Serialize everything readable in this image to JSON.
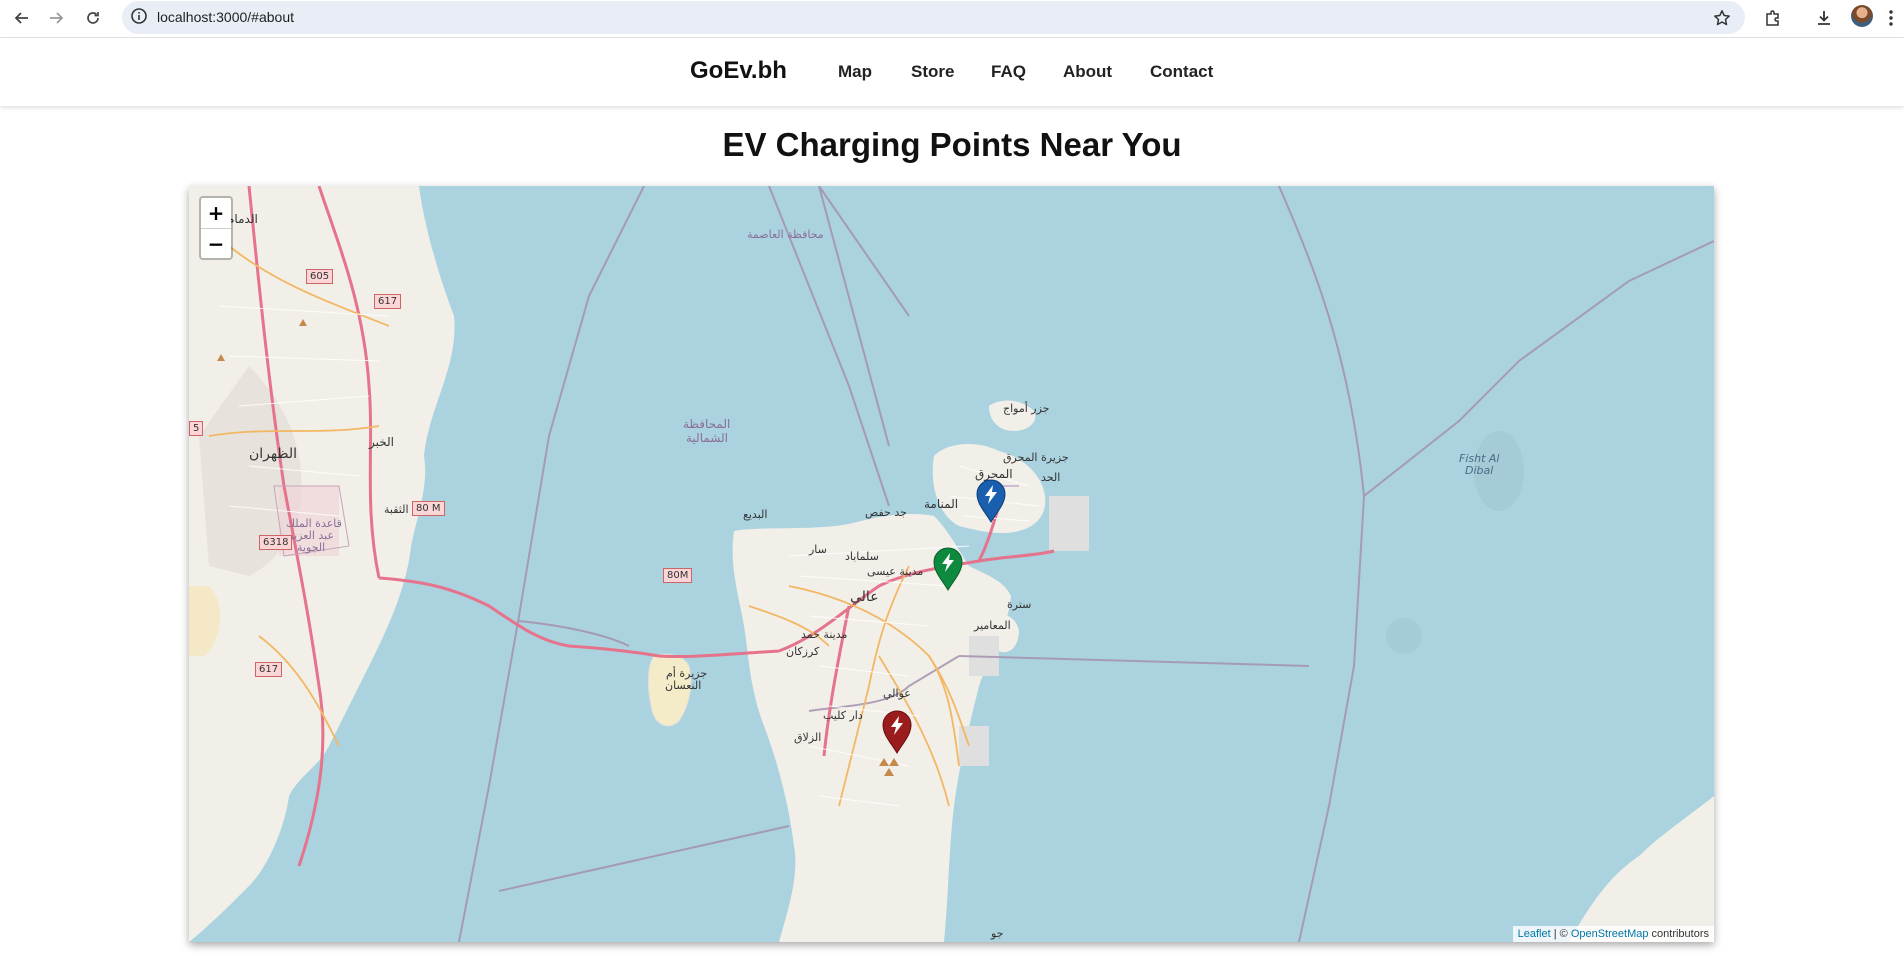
{
  "browser": {
    "url": "localhost:3000/#about"
  },
  "header": {
    "brand": "GoEv.bh",
    "nav": [
      {
        "label": "Map"
      },
      {
        "label": "Store"
      },
      {
        "label": "FAQ"
      },
      {
        "label": "About"
      },
      {
        "label": "Contact"
      }
    ]
  },
  "main": {
    "title": "EV Charging Points Near You"
  },
  "map": {
    "zoom_in": "+",
    "zoom_out": "−",
    "markers": [
      {
        "color": "#1a5fae",
        "name": "blue"
      },
      {
        "color": "#0e8a3f",
        "name": "green"
      },
      {
        "color": "#9b1c1c",
        "name": "red"
      }
    ],
    "labels": {
      "capital_gov": "محافظة العاصمة",
      "northern_gov_1": "المحافظة",
      "northern_gov_2": "الشمالية",
      "muharraq_island": "جزيرة المحرق",
      "muharraq": "المحرق",
      "amwaj": "جزر أمواج",
      "hidd": "الحد",
      "manama": "المنامة",
      "jidhafs": "جد حفص",
      "budaiya": "البديع",
      "saar": "سار",
      "salmabad": "سلماباد",
      "isa_town": "مدينة عيسى",
      "aali": "عالي",
      "sitra": "سترة",
      "maameer": "المعامير",
      "hamad_town": "مدينة حمد",
      "karzakan": "كرزكان",
      "awali": "عوالي",
      "dar_kulaib": "دار كليب",
      "zallaq": "الزلاق",
      "umm_nasan_1": "جزيرة أم",
      "umm_nasan_2": "النعسان",
      "dhahran": "الظهران",
      "khobar": "الخبر",
      "dammam": "الدمام",
      "thuqbah": "الثقبة",
      "airport_1": "قاعدة الملك",
      "airport_2": "عبد العزيز",
      "airport_3": "الجوية",
      "fasht_1": "Fisht Al",
      "fasht_2": "Dibal",
      "jaw": "جو",
      "sh_605": "605",
      "sh_617a": "617",
      "sh_617b": "617",
      "sh_6318": "6318",
      "sh_80m_a": "80 M",
      "sh_80m_b": "80M",
      "sh_5": "5"
    },
    "attribution": {
      "leaflet": "Leaflet",
      "sep": " | © ",
      "osm": "OpenStreetMap",
      "suffix": " contributors"
    }
  }
}
